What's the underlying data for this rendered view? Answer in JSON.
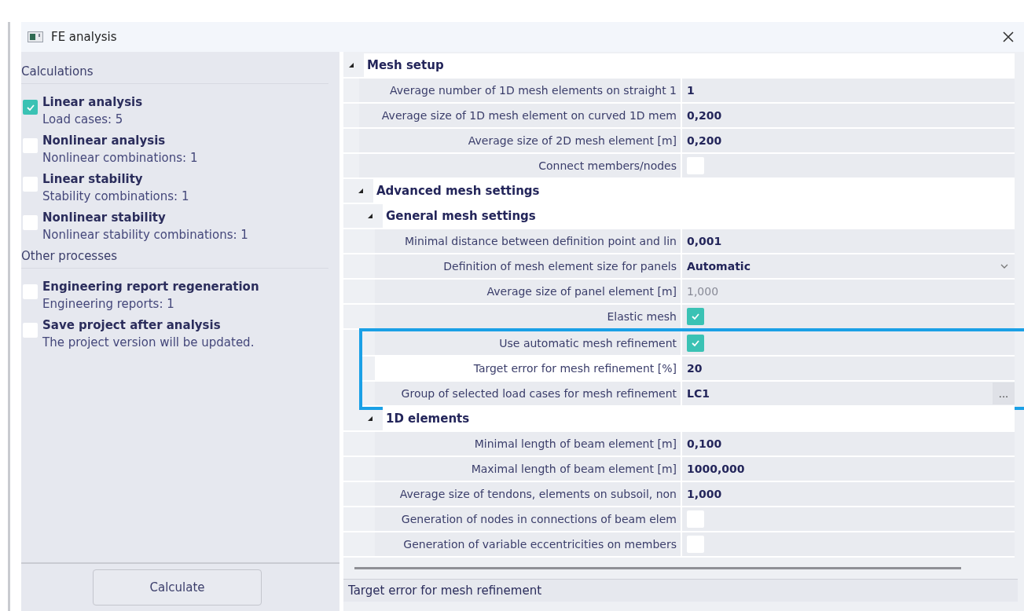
{
  "window": {
    "title": "FE analysis"
  },
  "calculations": [
    {
      "title": "Calculations",
      "items": [
        {
          "label": "Linear analysis",
          "detail": "Load cases: 5",
          "checked": true
        },
        {
          "label": "Nonlinear analysis",
          "detail": "Nonlinear combinations: 1",
          "checked": false
        },
        {
          "label": "Linear stability",
          "detail": "Stability combinations: 1",
          "checked": false
        },
        {
          "label": "Nonlinear stability",
          "detail": "Nonlinear stability combinations: 1",
          "checked": false
        }
      ]
    },
    {
      "title": "Other processes",
      "items": [
        {
          "label": "Engineering report regeneration",
          "detail": "Engineering reports: 1",
          "checked": false
        },
        {
          "label": "Save project after analysis",
          "detail": "The project version will be updated.",
          "checked": false
        }
      ]
    }
  ],
  "calculate_button": "Calculate",
  "grid": {
    "sections": [
      {
        "title": "Mesh setup",
        "expanded": true,
        "rows": [
          {
            "kind": "text",
            "label": "Average number of 1D mesh elements on straight 1",
            "value": "1",
            "disabled": false,
            "selected": false,
            "highlighted": false
          },
          {
            "kind": "text",
            "label": "Average size of 1D mesh element on curved 1D mem",
            "value": "0,200",
            "disabled": false,
            "selected": false,
            "highlighted": false
          },
          {
            "kind": "text",
            "label": "Average size of 2D mesh element [m]",
            "value": "0,200",
            "disabled": false,
            "selected": false,
            "highlighted": false
          },
          {
            "kind": "checkbox",
            "label": "Connect members/nodes",
            "checked": false,
            "selected": false,
            "highlighted": false
          }
        ],
        "children": [
          {
            "title": "Advanced mesh settings",
            "expanded": true,
            "children": [
              {
                "title": "General mesh settings",
                "expanded": true,
                "rows": [
                  {
                    "kind": "text",
                    "label": "Minimal distance between definition point and lin",
                    "value": "0,001",
                    "disabled": false,
                    "selected": false,
                    "highlighted": false
                  },
                  {
                    "kind": "dropdown",
                    "label": "Definition of mesh element size for panels",
                    "value": "Automatic",
                    "disabled": false,
                    "selected": false,
                    "highlighted": false
                  },
                  {
                    "kind": "text",
                    "label": "Average size of panel element [m]",
                    "value": "1,000",
                    "disabled": true,
                    "selected": false,
                    "highlighted": false
                  },
                  {
                    "kind": "checkbox",
                    "label": "Elastic mesh",
                    "checked": true,
                    "selected": false,
                    "highlighted": false
                  },
                  {
                    "kind": "checkbox",
                    "label": "Use automatic mesh refinement",
                    "checked": true,
                    "selected": false,
                    "highlighted": true
                  },
                  {
                    "kind": "text",
                    "label": "Target error for mesh refinement [%]",
                    "value": "20",
                    "disabled": false,
                    "selected": true,
                    "highlighted": true
                  },
                  {
                    "kind": "picker",
                    "label": "Group of selected load cases for mesh refinement",
                    "value": "LC1",
                    "button_label": "...",
                    "disabled": false,
                    "selected": false,
                    "highlighted": true
                  }
                ]
              },
              {
                "title": "1D elements",
                "expanded": true,
                "rows": [
                  {
                    "kind": "text",
                    "label": "Minimal length of beam element [m]",
                    "value": "0,100",
                    "disabled": false,
                    "selected": false,
                    "highlighted": false
                  },
                  {
                    "kind": "text",
                    "label": "Maximal length of beam element [m]",
                    "value": "1000,000",
                    "disabled": false,
                    "selected": false,
                    "highlighted": false
                  },
                  {
                    "kind": "text",
                    "label": "Average size of tendons, elements on subsoil, non",
                    "value": "1,000",
                    "disabled": false,
                    "selected": false,
                    "highlighted": false
                  },
                  {
                    "kind": "checkbox",
                    "label": "Generation of nodes in connections of beam elem",
                    "checked": false,
                    "selected": false,
                    "highlighted": false
                  },
                  {
                    "kind": "checkbox",
                    "label": "Generation of variable eccentricities on members",
                    "checked": false,
                    "selected": false,
                    "highlighted": false
                  }
                ]
              }
            ]
          }
        ]
      }
    ]
  },
  "status_bar": {
    "text": "Target error for mesh refinement"
  }
}
